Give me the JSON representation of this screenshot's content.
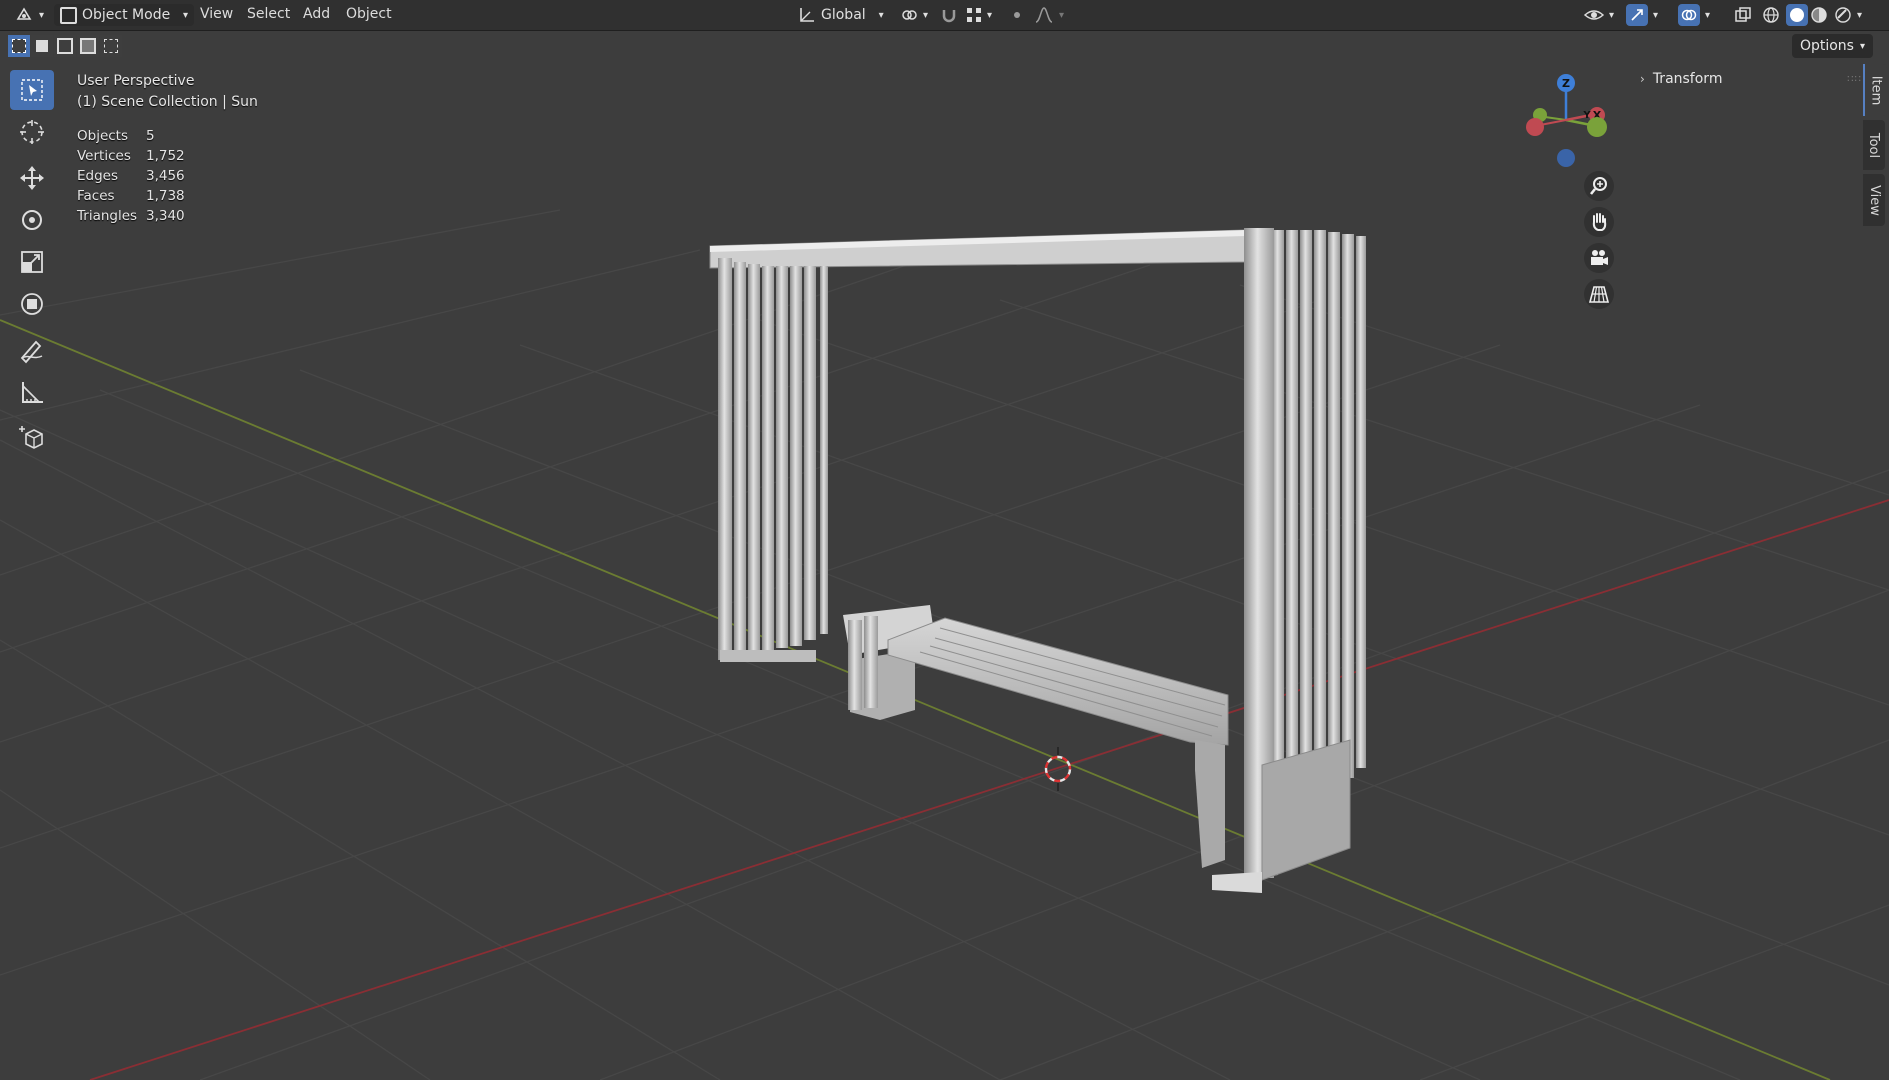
{
  "header": {
    "mode": "Object Mode",
    "menus": [
      "View",
      "Select",
      "Add",
      "Object"
    ],
    "transform_orientation": "Global"
  },
  "subheader": {
    "options_label": "Options"
  },
  "overlay": {
    "view_name": "User Perspective",
    "collection": "(1) Scene Collection | Sun",
    "stats": [
      {
        "label": "Objects",
        "value": "5"
      },
      {
        "label": "Vertices",
        "value": "1,752"
      },
      {
        "label": "Edges",
        "value": "3,456"
      },
      {
        "label": "Faces",
        "value": "1,738"
      },
      {
        "label": "Triangles",
        "value": "3,340"
      }
    ]
  },
  "gizmo": {
    "x": "X",
    "y": "Y",
    "z": "Z"
  },
  "n_panel": {
    "section": "Transform"
  },
  "sidebar_tabs": [
    "Item",
    "Tool",
    "View"
  ],
  "colors": {
    "accent": "#4772b3",
    "x_axis": "#c04a52",
    "y_axis": "#7aa23a",
    "z_axis": "#3e7fd8"
  }
}
